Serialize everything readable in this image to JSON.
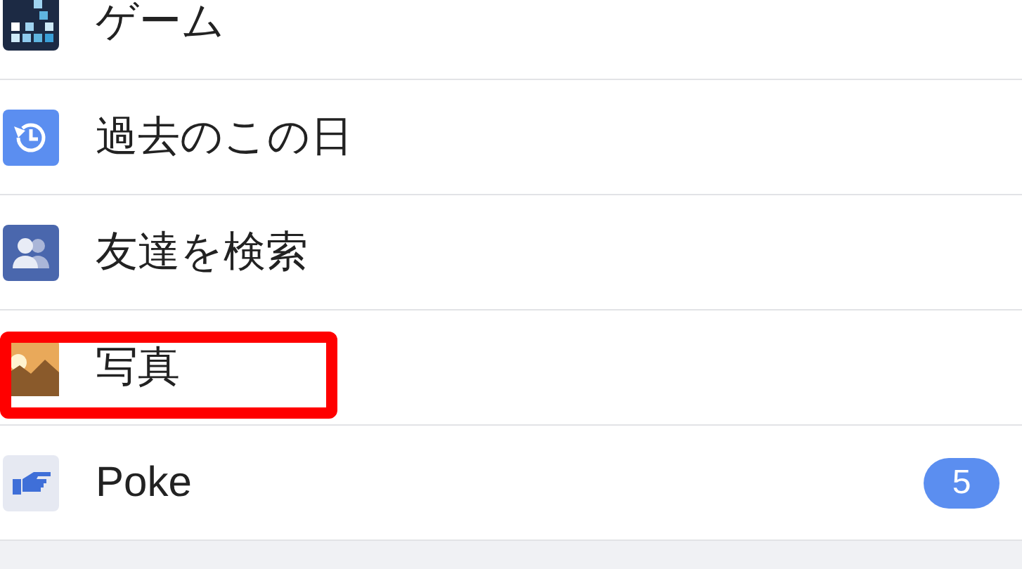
{
  "menu_items": [
    {
      "kind": "games",
      "label": "ゲーム",
      "highlighted": false
    },
    {
      "kind": "on_this_day",
      "label": "過去のこの日",
      "highlighted": false
    },
    {
      "kind": "find_friends",
      "label": "友達を検索",
      "highlighted": false
    },
    {
      "kind": "photos",
      "label": "写真",
      "highlighted": true
    },
    {
      "kind": "poke",
      "label": "Poke",
      "highlighted": false,
      "badge": "5"
    }
  ]
}
